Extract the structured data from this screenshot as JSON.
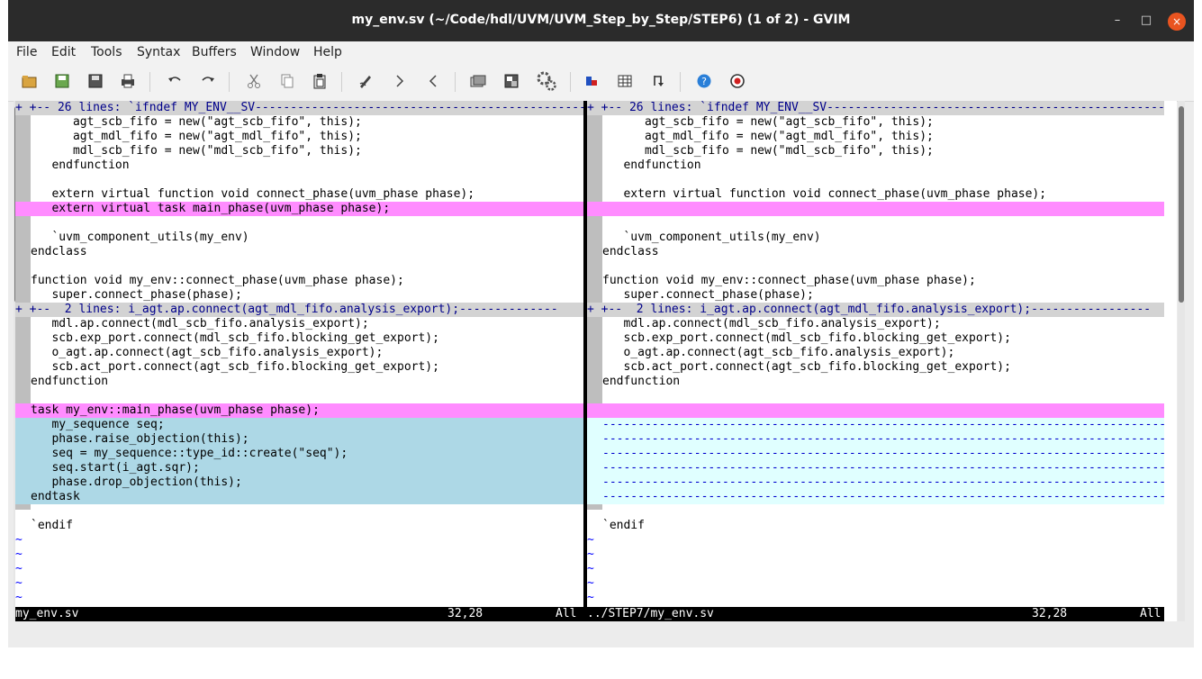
{
  "window": {
    "title": "my_env.sv (~/Code/hdl/UVM/UVM_Step_by_Step/STEP6) (1 of 2) - GVIM",
    "controls": {
      "minimize": "–",
      "maximize": "□",
      "close": "×"
    }
  },
  "menu": [
    "File",
    "Edit",
    "Tools",
    "Syntax",
    "Buffers",
    "Window",
    "Help"
  ],
  "toolbar": {
    "icons": [
      "open-icon",
      "save-icon",
      "save-all-icon",
      "print-icon",
      "undo-icon",
      "redo-icon",
      "cut-icon",
      "copy-icon",
      "paste-icon",
      "replace-icon",
      "find-next-icon",
      "find-prev-icon",
      "load-session-icon",
      "save-session-icon",
      "run-script-icon",
      "make-icon",
      "run-shell-icon",
      "tag-jump-icon",
      "help-icon",
      "find-help-icon"
    ]
  },
  "left": {
    "lines": [
      {
        "kind": "folded",
        "text": "+ +-- 26 lines: `ifndef MY_ENV__SV--------------------------------------------------"
      },
      {
        "kind": "code",
        "text": "      agt_scb_fifo = new(\"agt_scb_fifo\", this);"
      },
      {
        "kind": "code",
        "text": "      agt_mdl_fifo = new(\"agt_mdl_fifo\", this);"
      },
      {
        "kind": "code",
        "text": "      mdl_scb_fifo = new(\"mdl_scb_fifo\", this);"
      },
      {
        "kind": "code",
        "text": "   endfunction"
      },
      {
        "kind": "code",
        "text": ""
      },
      {
        "kind": "code",
        "text": "   extern virtual function void connect_phase(uvm_phase phase);"
      },
      {
        "kind": "chg",
        "text": "   extern virtual task main_phase(uvm_phase phase);"
      },
      {
        "kind": "code",
        "text": ""
      },
      {
        "kind": "code",
        "text": "   `uvm_component_utils(my_env)"
      },
      {
        "kind": "code",
        "text": "endclass"
      },
      {
        "kind": "code",
        "text": ""
      },
      {
        "kind": "code",
        "text": "function void my_env::connect_phase(uvm_phase phase);"
      },
      {
        "kind": "code",
        "text": "   super.connect_phase(phase);"
      },
      {
        "kind": "folded",
        "text": "+ +--  2 lines: i_agt.ap.connect(agt_mdl_fifo.analysis_export);--------------"
      },
      {
        "kind": "code",
        "text": "   mdl.ap.connect(mdl_scb_fifo.analysis_export);"
      },
      {
        "kind": "code",
        "text": "   scb.exp_port.connect(mdl_scb_fifo.blocking_get_export);"
      },
      {
        "kind": "code",
        "text": "   o_agt.ap.connect(agt_scb_fifo.analysis_export);"
      },
      {
        "kind": "code",
        "text": "   scb.act_port.connect(agt_scb_fifo.blocking_get_export);"
      },
      {
        "kind": "code",
        "text": "endfunction"
      },
      {
        "kind": "code",
        "text": ""
      },
      {
        "kind": "chg",
        "text": "task my_env::main_phase(uvm_phase phase);"
      },
      {
        "kind": "add",
        "text": "   my_sequence seq;"
      },
      {
        "kind": "add",
        "text": "   phase.raise_objection(this);"
      },
      {
        "kind": "add",
        "text": "   seq = my_sequence::type_id::create(\"seq\");"
      },
      {
        "kind": "add",
        "text": "   seq.start(i_agt.sqr);"
      },
      {
        "kind": "add",
        "text": "   phase.drop_objection(this);"
      },
      {
        "kind": "add",
        "text": "endtask"
      },
      {
        "kind": "code",
        "text": ""
      },
      {
        "kind": "code",
        "text": "`endif"
      },
      {
        "kind": "tilde",
        "text": "~"
      },
      {
        "kind": "tilde",
        "text": "~"
      },
      {
        "kind": "tilde",
        "text": "~"
      },
      {
        "kind": "tilde",
        "text": "~"
      },
      {
        "kind": "tilde",
        "text": "~"
      }
    ],
    "status": {
      "file": "my_env.sv",
      "pos": "32,28",
      "scroll": "All"
    }
  },
  "right": {
    "lines": [
      {
        "kind": "folded",
        "text": "+ +-- 26 lines: `ifndef MY_ENV__SV-----------------------------------------------------"
      },
      {
        "kind": "code",
        "text": "      agt_scb_fifo = new(\"agt_scb_fifo\", this);"
      },
      {
        "kind": "code",
        "text": "      agt_mdl_fifo = new(\"agt_mdl_fifo\", this);"
      },
      {
        "kind": "code",
        "text": "      mdl_scb_fifo = new(\"mdl_scb_fifo\", this);"
      },
      {
        "kind": "code",
        "text": "   endfunction"
      },
      {
        "kind": "code",
        "text": ""
      },
      {
        "kind": "code",
        "text": "   extern virtual function void connect_phase(uvm_phase phase);"
      },
      {
        "kind": "chg",
        "text": ""
      },
      {
        "kind": "code",
        "text": ""
      },
      {
        "kind": "code",
        "text": "   `uvm_component_utils(my_env)"
      },
      {
        "kind": "code",
        "text": "endclass"
      },
      {
        "kind": "code",
        "text": ""
      },
      {
        "kind": "code",
        "text": "function void my_env::connect_phase(uvm_phase phase);"
      },
      {
        "kind": "code",
        "text": "   super.connect_phase(phase);"
      },
      {
        "kind": "folded",
        "text": "+ +--  2 lines: i_agt.ap.connect(agt_mdl_fifo.analysis_export);-----------------"
      },
      {
        "kind": "code",
        "text": "   mdl.ap.connect(mdl_scb_fifo.analysis_export);"
      },
      {
        "kind": "code",
        "text": "   scb.exp_port.connect(mdl_scb_fifo.blocking_get_export);"
      },
      {
        "kind": "code",
        "text": "   o_agt.ap.connect(agt_scb_fifo.analysis_export);"
      },
      {
        "kind": "code",
        "text": "   scb.act_port.connect(agt_scb_fifo.blocking_get_export);"
      },
      {
        "kind": "code",
        "text": "endfunction"
      },
      {
        "kind": "code",
        "text": ""
      },
      {
        "kind": "chg",
        "text": ""
      },
      {
        "kind": "del",
        "text": "--------------------------------------------------------------------------------"
      },
      {
        "kind": "del",
        "text": "--------------------------------------------------------------------------------"
      },
      {
        "kind": "del",
        "text": "--------------------------------------------------------------------------------"
      },
      {
        "kind": "del",
        "text": "--------------------------------------------------------------------------------"
      },
      {
        "kind": "del",
        "text": "--------------------------------------------------------------------------------"
      },
      {
        "kind": "del",
        "text": "--------------------------------------------------------------------------------"
      },
      {
        "kind": "code",
        "text": ""
      },
      {
        "kind": "code",
        "text": "`endif"
      },
      {
        "kind": "tilde",
        "text": "~"
      },
      {
        "kind": "tilde",
        "text": "~"
      },
      {
        "kind": "tilde",
        "text": "~"
      },
      {
        "kind": "tilde",
        "text": "~"
      },
      {
        "kind": "tilde",
        "text": "~"
      }
    ],
    "status": {
      "file": "../STEP7/my_env.sv",
      "pos": "32,28",
      "scroll": "All"
    }
  }
}
